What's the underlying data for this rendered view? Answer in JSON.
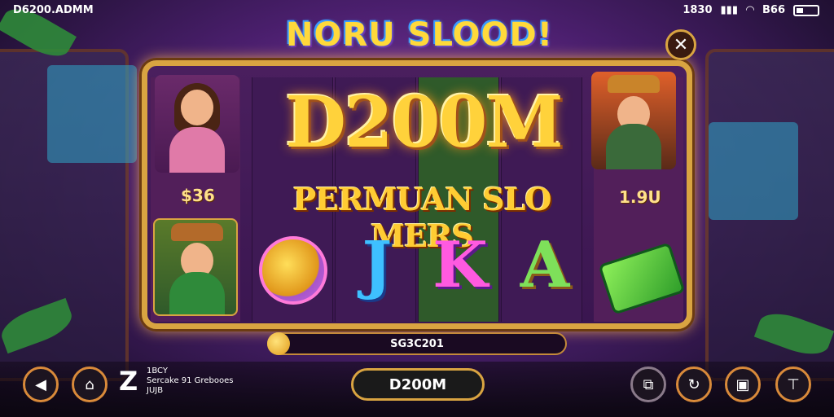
{
  "status": {
    "left_text": "D6200.ADMM",
    "time": "1830",
    "battery": "B66"
  },
  "title": "NORU SLOOD!",
  "close_icon": "close-icon",
  "banner": {
    "big": "D200M",
    "sub": "PERMUAN SLO MERS"
  },
  "left_column": {
    "value": "$36"
  },
  "right_column": {
    "value": "1.9U"
  },
  "symbols": [
    "J",
    "K",
    "A"
  ],
  "progress": {
    "label": "SG3C201"
  },
  "bottom": {
    "info_glyph": "Z",
    "info_line1": "1BCY",
    "info_line2": "Sercake  91 Grebooes",
    "info_line3": "JUJB",
    "spin_label": "D200M",
    "left_buttons": [
      "sound-icon",
      "home-icon"
    ],
    "right_buttons": [
      "copy-icon",
      "refresh-icon",
      "image-icon",
      "settings-icon"
    ]
  },
  "colors": {
    "gold": "#d9a441",
    "title_yellow": "#ffd93b",
    "background": "#4b1f6e"
  }
}
